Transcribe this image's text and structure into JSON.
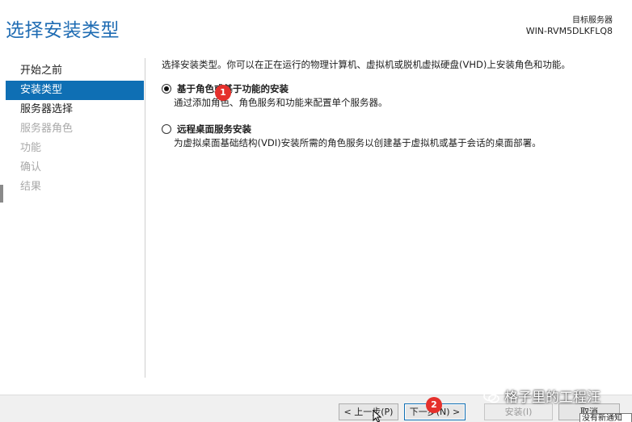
{
  "header": {
    "title": "选择安装类型",
    "dest_label": "目标服务器",
    "server_name": "WIN-RVM5DLKFLQ8"
  },
  "nav": {
    "items": [
      {
        "label": "开始之前",
        "state": "normal"
      },
      {
        "label": "安装类型",
        "state": "active"
      },
      {
        "label": "服务器选择",
        "state": "normal"
      },
      {
        "label": "服务器角色",
        "state": "disabled"
      },
      {
        "label": "功能",
        "state": "disabled"
      },
      {
        "label": "确认",
        "state": "disabled"
      },
      {
        "label": "结果",
        "state": "disabled"
      }
    ]
  },
  "content": {
    "intro": "选择安装类型。你可以在正在运行的物理计算机、虚拟机或脱机虚拟硬盘(VHD)上安装角色和功能。",
    "options": [
      {
        "title": "基于角色或基于功能的安装",
        "desc": "通过添加角色、角色服务和功能来配置单个服务器。",
        "checked": true
      },
      {
        "title": "远程桌面服务安装",
        "desc": "为虚拟桌面基础结构(VDI)安装所需的角色服务以创建基于虚拟机或基于会话的桌面部署。",
        "checked": false
      }
    ]
  },
  "buttons": {
    "prev": "< 上一步(P)",
    "next": "下一步(N) >",
    "install": "安装(I)",
    "cancel": "取消"
  },
  "badges": {
    "one": "1",
    "two": "2"
  },
  "tooltip": "没有新通知",
  "watermark": "格子里的工程汪",
  "colors": {
    "accent": "#0f6fb4",
    "title": "#1f6cb3",
    "badge": "#e5302c"
  }
}
